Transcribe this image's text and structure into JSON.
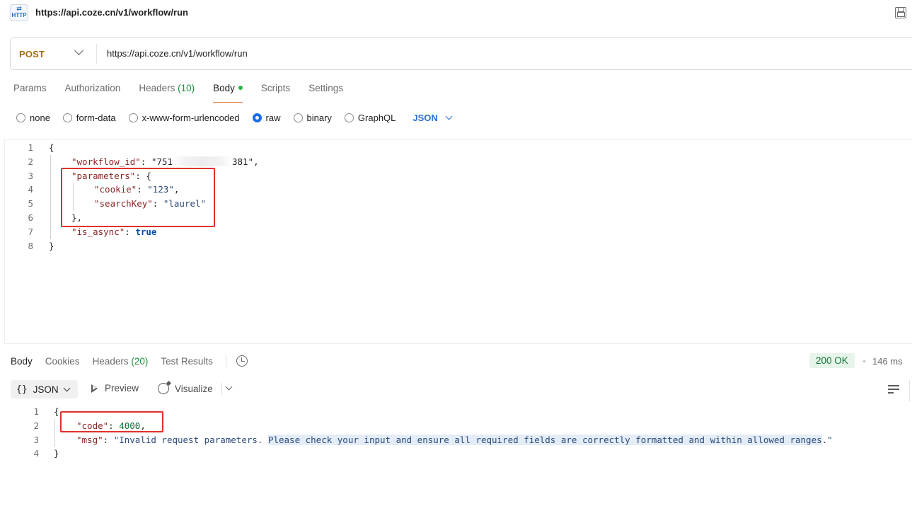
{
  "title_bar": {
    "icon_text": "HTTP",
    "icon_name": "http-request-icon",
    "title": "https://api.coze.cn/v1/workflow/run",
    "save_icon": "save-icon"
  },
  "url_bar": {
    "method": "POST",
    "url": "https://api.coze.cn/v1/workflow/run"
  },
  "request_tabs": [
    {
      "label": "Params"
    },
    {
      "label": "Authorization"
    },
    {
      "label": "Headers",
      "count": "(10)"
    },
    {
      "label": "Body",
      "active": true
    },
    {
      "label": "Scripts"
    },
    {
      "label": "Settings"
    }
  ],
  "body_types": [
    {
      "label": "none"
    },
    {
      "label": "form-data"
    },
    {
      "label": "x-www-form-urlencoded"
    },
    {
      "label": "raw",
      "checked": true
    },
    {
      "label": "binary"
    },
    {
      "label": "GraphQL"
    }
  ],
  "raw_format": "JSON",
  "request_body": {
    "line_numbers": [
      "1",
      "2",
      "3",
      "4",
      "5",
      "6",
      "7",
      "8"
    ],
    "open_brace": "{",
    "close_brace": "}",
    "workflow_id_key": "\"workflow_id\"",
    "workflow_id_prefix": ": \"751",
    "workflow_id_suffix": "381\",",
    "parameters_key": "\"parameters\"",
    "parameters_open": ": {",
    "cookie_key": "\"cookie\"",
    "cookie_value": "\"123\"",
    "searchkey_key": "\"searchKey\"",
    "searchkey_value": "\"laurel\"",
    "parameters_close": "},",
    "is_async_key": "\"is_async\"",
    "is_async_value": "true"
  },
  "response_tabs": [
    {
      "label": "Body",
      "active": true
    },
    {
      "label": "Cookies"
    },
    {
      "label": "Headers",
      "count": "(20)"
    },
    {
      "label": "Test Results"
    }
  ],
  "response_status": {
    "status": "200 OK",
    "time": "146 ms"
  },
  "response_toolbar": {
    "format": "JSON",
    "braces": "{}",
    "preview": "Preview",
    "visualize": "Visualize"
  },
  "response_body": {
    "line_numbers": [
      "1",
      "2",
      "3",
      "4"
    ],
    "open_brace": "{",
    "close_brace": "}",
    "code_key": "\"code\"",
    "code_value": "4000",
    "msg_key": "\"msg\"",
    "msg_value_start": "\"Invalid request parameters. ",
    "msg_value_highlight": "Please check your input and ensure all required fields are correctly formatted and within allowed ranges",
    "msg_value_end": ".\""
  },
  "colors": {
    "method": "#a86b0b",
    "active_tab_underline": "#e07b3c",
    "accent_blue": "#1a6ee6",
    "status_bg": "#e6f4e9",
    "status_text": "#137333",
    "annotation_red": "#e0312b"
  }
}
